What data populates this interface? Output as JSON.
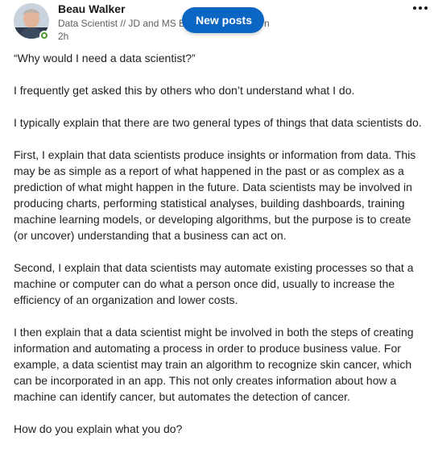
{
  "author": {
    "name": "Beau Walker",
    "headline_visible": "Data Scientist // JD and MS E",
    "headline_tail": "n",
    "time": "2h",
    "avatar_icon": "profile-photo",
    "status_icon": "online-status-icon"
  },
  "menu": {
    "icon": "more-options-icon"
  },
  "new_posts": {
    "label": "New posts",
    "color": "#0a66c2"
  },
  "post": {
    "paragraphs": [
      "“Why would I need a data scientist?”",
      "I frequently get asked this by others who don’t understand what I do.",
      "I typically explain that there are two general types of things that data scientists do.",
      "First, I explain that data scientists produce insights or information from data. This may be as simple as a report of what happened in the past or as complex as a prediction of what might happen in the future. Data scientists may be involved in producing charts, performing statistical analyses, building dashboards, training machine learning models, or developing algorithms, but the purpose is to create (or uncover) understanding that a business can act on.",
      "Second, I explain that data scientists may automate existing processes so that a machine or computer can do what a person once did, usually to increase the efficiency of an organization and lower costs.",
      "I then explain that a data scientist might be involved in both the steps of creating information and automating a process in order to produce business value. For example, a data scientist may train an algorithm to recognize skin cancer, which can be incorporated in an app. This not only creates information about how a machine can identify cancer, but automates the detection of cancer.",
      "How do you explain what you do?"
    ]
  }
}
